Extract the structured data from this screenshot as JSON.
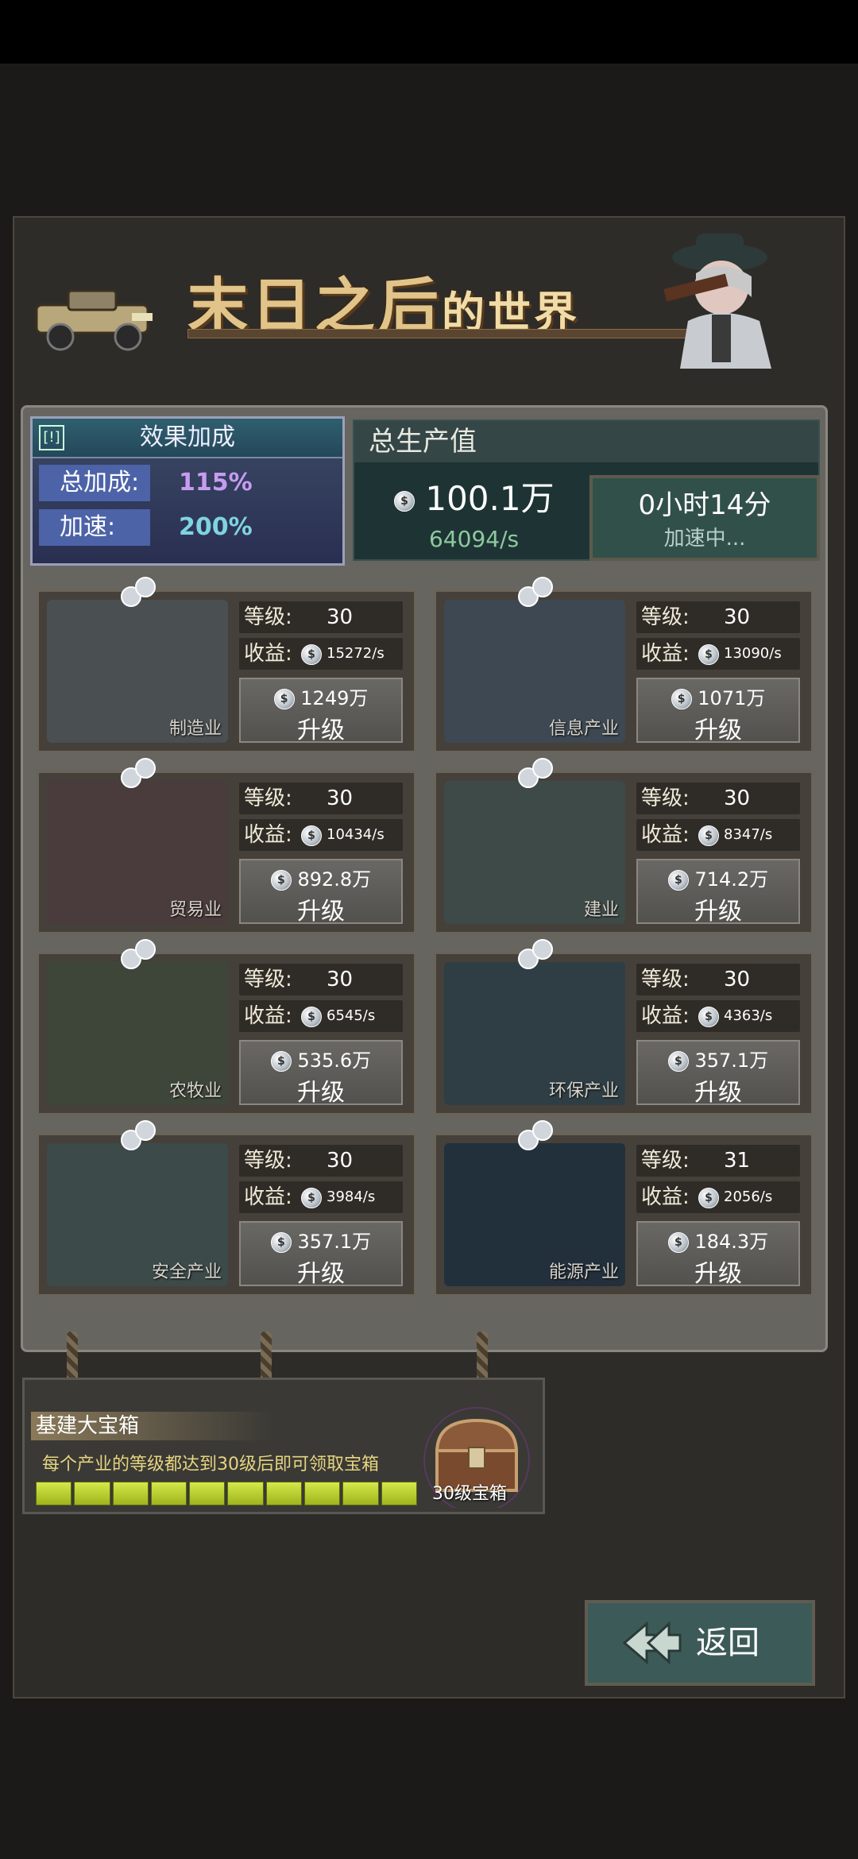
{
  "banner": {
    "title_main": "末日之后",
    "title_small": "的世界"
  },
  "bonus": {
    "header": "效果加成",
    "header_tag": "[!]",
    "total_label": "总加成:",
    "total_value": "115%",
    "speed_label": "加速:",
    "speed_value": "200%"
  },
  "output": {
    "header": "总生产值",
    "total": "100.1万",
    "rate": "64094/s",
    "speedup_time": "0小时14分",
    "speedup_status": "加速中..."
  },
  "labels": {
    "level": "等级:",
    "income": "收益:",
    "upgrade": "升级"
  },
  "industries": [
    {
      "name": "制造业",
      "level": "30",
      "income": "15272/s",
      "cost": "1249万"
    },
    {
      "name": "信息产业",
      "level": "30",
      "income": "13090/s",
      "cost": "1071万"
    },
    {
      "name": "贸易业",
      "level": "30",
      "income": "10434/s",
      "cost": "892.8万"
    },
    {
      "name": "建业",
      "level": "30",
      "income": "8347/s",
      "cost": "714.2万"
    },
    {
      "name": "农牧业",
      "level": "30",
      "income": "6545/s",
      "cost": "535.6万"
    },
    {
      "name": "环保产业",
      "level": "30",
      "income": "4363/s",
      "cost": "357.1万"
    },
    {
      "name": "安全产业",
      "level": "30",
      "income": "3984/s",
      "cost": "357.1万"
    },
    {
      "name": "能源产业",
      "level": "31",
      "income": "2056/s",
      "cost": "184.3万"
    }
  ],
  "chest": {
    "title": "基建大宝箱",
    "desc": "每个产业的等级都达到30级后即可领取宝箱",
    "label": "30级宝箱",
    "progress_filled": 10,
    "progress_total": 10
  },
  "back_button": "返回",
  "colors": {
    "bonus_total": "#c79cf0",
    "bonus_speed": "#7fd4e0",
    "progress": "#c8dc3a"
  }
}
